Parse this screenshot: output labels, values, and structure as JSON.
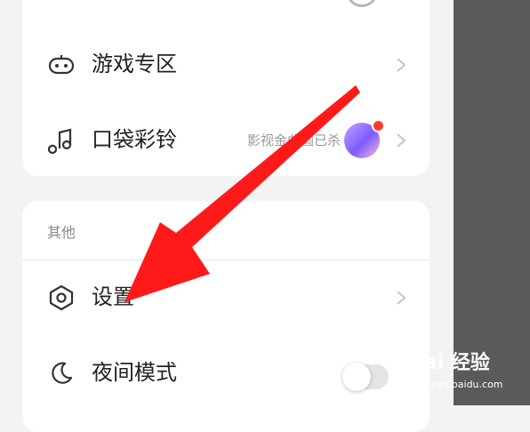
{
  "menu": {
    "games": {
      "label": "游戏专区",
      "icon": "gamepad-icon"
    },
    "ringtone": {
      "label": "口袋彩铃",
      "subtitle": "影视金曲圆已杀",
      "icon": "music-note-icon"
    }
  },
  "other_section": {
    "header": "其他",
    "settings": {
      "label": "设置",
      "icon": "hexagon-settings-icon"
    },
    "night_mode": {
      "label": "夜间模式",
      "icon": "moon-icon",
      "enabled": false
    }
  },
  "watermark": {
    "main": "Bai 经验",
    "sub": "jingyan.baidu.com"
  },
  "colors": {
    "arrow": "#ff1a1a",
    "overlay": "#5a5a5a",
    "card": "#ffffff",
    "background": "#f3f3f3"
  }
}
